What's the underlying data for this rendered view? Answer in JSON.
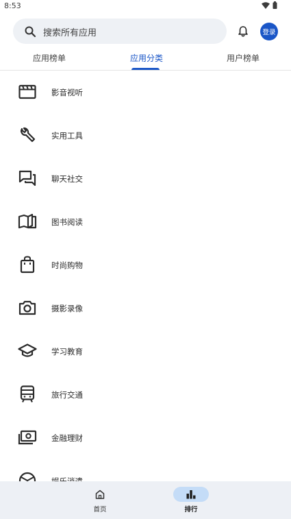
{
  "status_bar": {
    "time": "8:53"
  },
  "search": {
    "placeholder": "搜索所有应用"
  },
  "header": {
    "login_label": "登录"
  },
  "tabs": [
    {
      "label": "应用榜单"
    },
    {
      "label": "应用分类"
    },
    {
      "label": "用户榜单"
    }
  ],
  "active_tab": "应用分类",
  "categories": [
    {
      "label": "影音视听",
      "icon": "clapperboard-icon"
    },
    {
      "label": "实用工具",
      "icon": "wrench-icon"
    },
    {
      "label": "聊天社交",
      "icon": "chat-icon"
    },
    {
      "label": "图书阅读",
      "icon": "book-icon"
    },
    {
      "label": "时尚购物",
      "icon": "shopping-bag-icon"
    },
    {
      "label": "摄影录像",
      "icon": "camera-icon"
    },
    {
      "label": "学习教育",
      "icon": "graduation-cap-icon"
    },
    {
      "label": "旅行交通",
      "icon": "train-icon"
    },
    {
      "label": "金融理财",
      "icon": "money-icon"
    },
    {
      "label": "娱乐消遣",
      "icon": "entertainment-icon"
    }
  ],
  "bottom_nav": [
    {
      "label": "首页",
      "icon": "home-icon"
    },
    {
      "label": "排行",
      "icon": "ranking-icon"
    }
  ],
  "colors": {
    "accent": "#1a56c7",
    "search_bg": "#eef1f5",
    "nav_bg": "#edf0f5",
    "nav_active_pill": "#c4dcf7"
  }
}
